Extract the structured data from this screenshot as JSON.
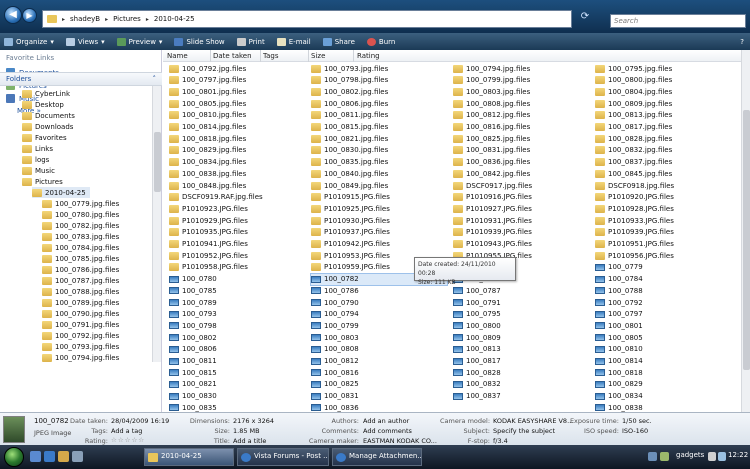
{
  "address": {
    "crumbs": [
      "shadeyB",
      "Pictures",
      "2010-04-25"
    ],
    "search_placeholder": "Search"
  },
  "toolbar": [
    "Organize",
    "Views",
    "Preview",
    "Slide Show",
    "Print",
    "E-mail",
    "Share",
    "Burn"
  ],
  "nav": {
    "favorites_header": "Favorite Links",
    "favorites": [
      "Documents",
      "Pictures",
      "Music"
    ],
    "more": "More",
    "folders_header": "Folders",
    "tree": [
      "CyberLink",
      "Desktop",
      "Documents",
      "Downloads",
      "Favorites",
      "Links",
      "logs",
      "Music",
      "Pictures",
      "2010-04-25",
      "100_0779.jpg.files",
      "100_0780.jpg.files",
      "100_0782.jpg.files",
      "100_0783.jpg.files",
      "100_0784.jpg.files",
      "100_0785.jpg.files",
      "100_0786.jpg.files",
      "100_0787.jpg.files",
      "100_0788.jpg.files",
      "100_0789.jpg.files",
      "100_0790.jpg.files",
      "100_0791.jpg.files",
      "100_0792.jpg.files",
      "100_0793.jpg.files",
      "100_0794.jpg.files"
    ]
  },
  "columns": [
    "Name",
    "Date taken",
    "Tags",
    "Size",
    "Rating"
  ],
  "files": {
    "col1": [
      "100_0792.jpg.files",
      "100_0797.jpg.files",
      "100_0801.jpg.files",
      "100_0805.jpg.files",
      "100_0810.jpg.files",
      "100_0814.jpg.files",
      "100_0818.jpg.files",
      "100_0829.jpg.files",
      "100_0834.jpg.files",
      "100_0838.jpg.files",
      "100_0848.jpg.files",
      "DSCF0919.RAF.jpg.files",
      "P1010923.JPG.files",
      "P1010929.JPG.files",
      "P1010935.JPG.files",
      "P1010941.JPG.files",
      "P1010952.JPG.files",
      "P1010958.JPG.files",
      "100_0780",
      "100_0785",
      "100_0789",
      "100_0793",
      "100_0798",
      "100_0802",
      "100_0806",
      "100_0811",
      "100_0815",
      "100_0821",
      "100_0830",
      "100_0835"
    ],
    "col2": [
      "100_0793.jpg.files",
      "100_0798.jpg.files",
      "100_0802.jpg.files",
      "100_0806.jpg.files",
      "100_0811.jpg.files",
      "100_0815.jpg.files",
      "100_0821.jpg.files",
      "100_0830.jpg.files",
      "100_0835.jpg.files",
      "100_0840.jpg.files",
      "100_0849.jpg.files",
      "P1010915.JPG.files",
      "P1010925.JPG.files",
      "P1010930.JPG.files",
      "P1010937.JPG.files",
      "P1010942.JPG.files",
      "P1010953.JPG.files",
      "P1010959.JPG.files",
      "100_0782",
      "100_0786",
      "100_0790",
      "100_0794",
      "100_0799",
      "100_0803",
      "100_0808",
      "100_0812",
      "100_0816",
      "100_0825",
      "100_0831",
      "100_0836"
    ],
    "col3": [
      "100_0794.jpg.files",
      "100_0799.jpg.files",
      "100_0803.jpg.files",
      "100_0808.jpg.files",
      "100_0812.jpg.files",
      "100_0816.jpg.files",
      "100_0825.jpg.files",
      "100_0831.jpg.files",
      "100_0836.jpg.files",
      "100_0842.jpg.files",
      "DSCF0917.jpg.files",
      "P1010916.JPG.files",
      "P1010927.JPG.files",
      "P1010931.JPG.files",
      "P1010939.JPG.files",
      "P1010943.JPG.files",
      "P1010955.JPG.files",
      "100_0779",
      "100_0783",
      "100_0787",
      "100_0791",
      "100_0795",
      "100_0800",
      "100_0809",
      "100_0813",
      "100_0817",
      "100_0828",
      "100_0832",
      "100_0837"
    ],
    "col4": [
      "100_0795.jpg.files",
      "100_0800.jpg.files",
      "100_0804.jpg.files",
      "100_0809.jpg.files",
      "100_0813.jpg.files",
      "100_0817.jpg.files",
      "100_0828.jpg.files",
      "100_0832.jpg.files",
      "100_0837.jpg.files",
      "100_0845.jpg.files",
      "DSCF0918.jpg.files",
      "P1010920.JPG.files",
      "P1010928.JPG.files",
      "P1010933.JPG.files",
      "P1010939.JPG.files",
      "P1010951.JPG.files",
      "P1010956.JPG.files",
      "100_0779",
      "100_0784",
      "100_0788",
      "100_0792",
      "100_0797",
      "100_0801",
      "100_0805",
      "100_0810",
      "100_0814",
      "100_0818",
      "100_0829",
      "100_0834",
      "100_0838"
    ]
  },
  "tooltip": {
    "date": "Date created: 24/11/2010 00:28",
    "size": "Size: 111 KB"
  },
  "details": {
    "name": "100_0782",
    "type": "JPEG Image",
    "labels": {
      "date_taken": "Date taken:",
      "tags": "Tags:",
      "rating": "Rating:",
      "dimensions": "Dimensions:",
      "size": "Size:",
      "title": "Title:",
      "authors": "Authors:",
      "comments": "Comments:",
      "camera_maker": "Camera maker:",
      "camera_model": "Camera model:",
      "subject": "Subject:",
      "fstop": "F-stop:",
      "exposure": "Exposure time:",
      "iso": "ISO speed:"
    },
    "values": {
      "date_taken": "28/04/2009 16:19",
      "tags": "Add a tag",
      "rating": "☆☆☆☆☆",
      "dimensions": "2176 x 3264",
      "size": "1.85 MB",
      "title": "Add a title",
      "authors": "Add an author",
      "comments": "Add comments",
      "camera_maker": "EASTMAN KODAK CO...",
      "camera_model": "KODAK EASYSHARE V8...",
      "subject": "Specify the subject",
      "fstop": "f/3.4",
      "exposure": "1/50 sec.",
      "iso": "ISO-160"
    }
  },
  "taskbar": {
    "buttons": [
      "2010-04-25",
      "Vista Forums - Post ...",
      "Manage Attachmen..."
    ],
    "gadgets": "gadgets",
    "clock": "12:22"
  },
  "colors": {
    "title_bar": "#1d4f7e",
    "toolbar": "#2b4a68",
    "taskbar": "#1c2636",
    "link": "#1d4f9a"
  }
}
